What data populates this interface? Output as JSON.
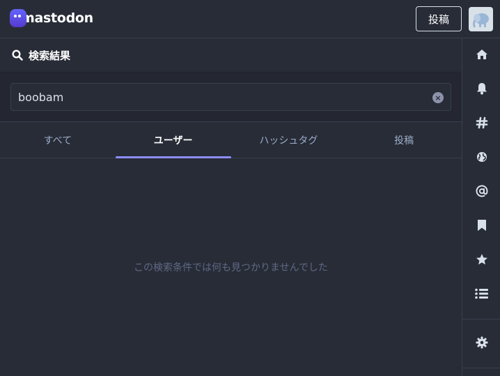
{
  "header": {
    "logo_text": "mastodon",
    "compose_label": "投稿"
  },
  "column": {
    "title": "検索結果"
  },
  "search": {
    "value": "boobam"
  },
  "tabs": [
    {
      "label": "すべて",
      "active": false
    },
    {
      "label": "ユーザー",
      "active": true
    },
    {
      "label": "ハッシュタグ",
      "active": false
    },
    {
      "label": "投稿",
      "active": false
    }
  ],
  "empty_message": "この検索条件では何も見つかりませんでした",
  "nav": {
    "icons": [
      "home-icon",
      "bell-icon",
      "hashtag-icon",
      "globe-icon",
      "at-icon",
      "bookmark-icon",
      "star-icon",
      "list-icon",
      "gear-icon"
    ]
  },
  "colors": {
    "background": "#282c37",
    "accent": "#8c8dff",
    "text_primary": "#ffffff",
    "text_secondary": "#9baec8",
    "muted": "#606984"
  }
}
